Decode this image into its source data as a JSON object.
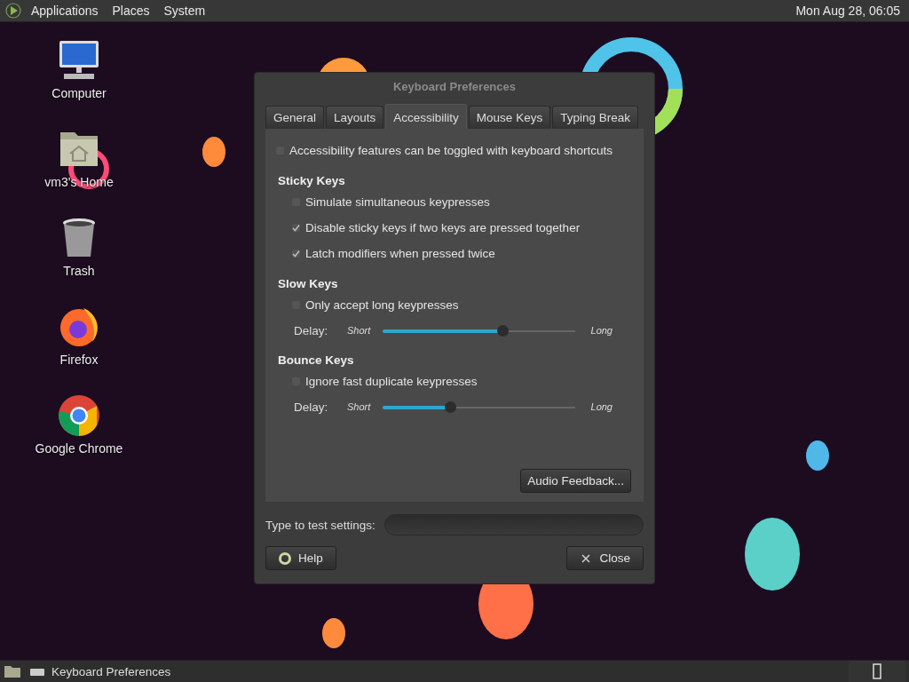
{
  "top_panel": {
    "menus": [
      "Applications",
      "Places",
      "System"
    ],
    "clock": "Mon Aug 28, 06:05"
  },
  "desktop_icons": [
    {
      "kind": "computer",
      "label": "Computer"
    },
    {
      "kind": "home",
      "label": "vm3's Home"
    },
    {
      "kind": "trash",
      "label": "Trash"
    },
    {
      "kind": "firefox",
      "label": "Firefox"
    },
    {
      "kind": "chrome",
      "label": "Google Chrome"
    }
  ],
  "dialog": {
    "title": "Keyboard Preferences",
    "tabs": [
      {
        "label": "General",
        "selected": false
      },
      {
        "label": "Layouts",
        "selected": false
      },
      {
        "label": "Accessibility",
        "selected": true
      },
      {
        "label": "Mouse Keys",
        "selected": false
      },
      {
        "label": "Typing Break",
        "selected": false
      }
    ],
    "shortcut_toggle": {
      "label": "Accessibility features can be toggled with keyboard shortcuts",
      "checked": false
    },
    "sections": [
      {
        "heading": "Sticky Keys",
        "options": [
          {
            "label": "Simulate simultaneous keypresses",
            "checked": false
          },
          {
            "label": "Disable sticky keys if two keys are pressed together",
            "checked": true
          },
          {
            "label": "Latch modifiers when pressed twice",
            "checked": true
          }
        ]
      },
      {
        "heading": "Slow Keys",
        "options": [
          {
            "label": "Only accept long keypresses",
            "checked": false
          }
        ],
        "delay": {
          "label": "Delay:",
          "min_label": "Short",
          "max_label": "Long",
          "level": 0.59
        }
      },
      {
        "heading": "Bounce Keys",
        "options": [
          {
            "label": "Ignore fast duplicate keypresses",
            "checked": false
          }
        ],
        "delay": {
          "label": "Delay:",
          "min_label": "Short",
          "max_label": "Long",
          "level": 0.33
        }
      }
    ],
    "audio_button": "Audio Feedback...",
    "test_field": {
      "label": "Type to test settings:"
    },
    "help_button": "Help",
    "close_button": "Close"
  },
  "taskbar": {
    "window_button": "Keyboard Preferences"
  }
}
